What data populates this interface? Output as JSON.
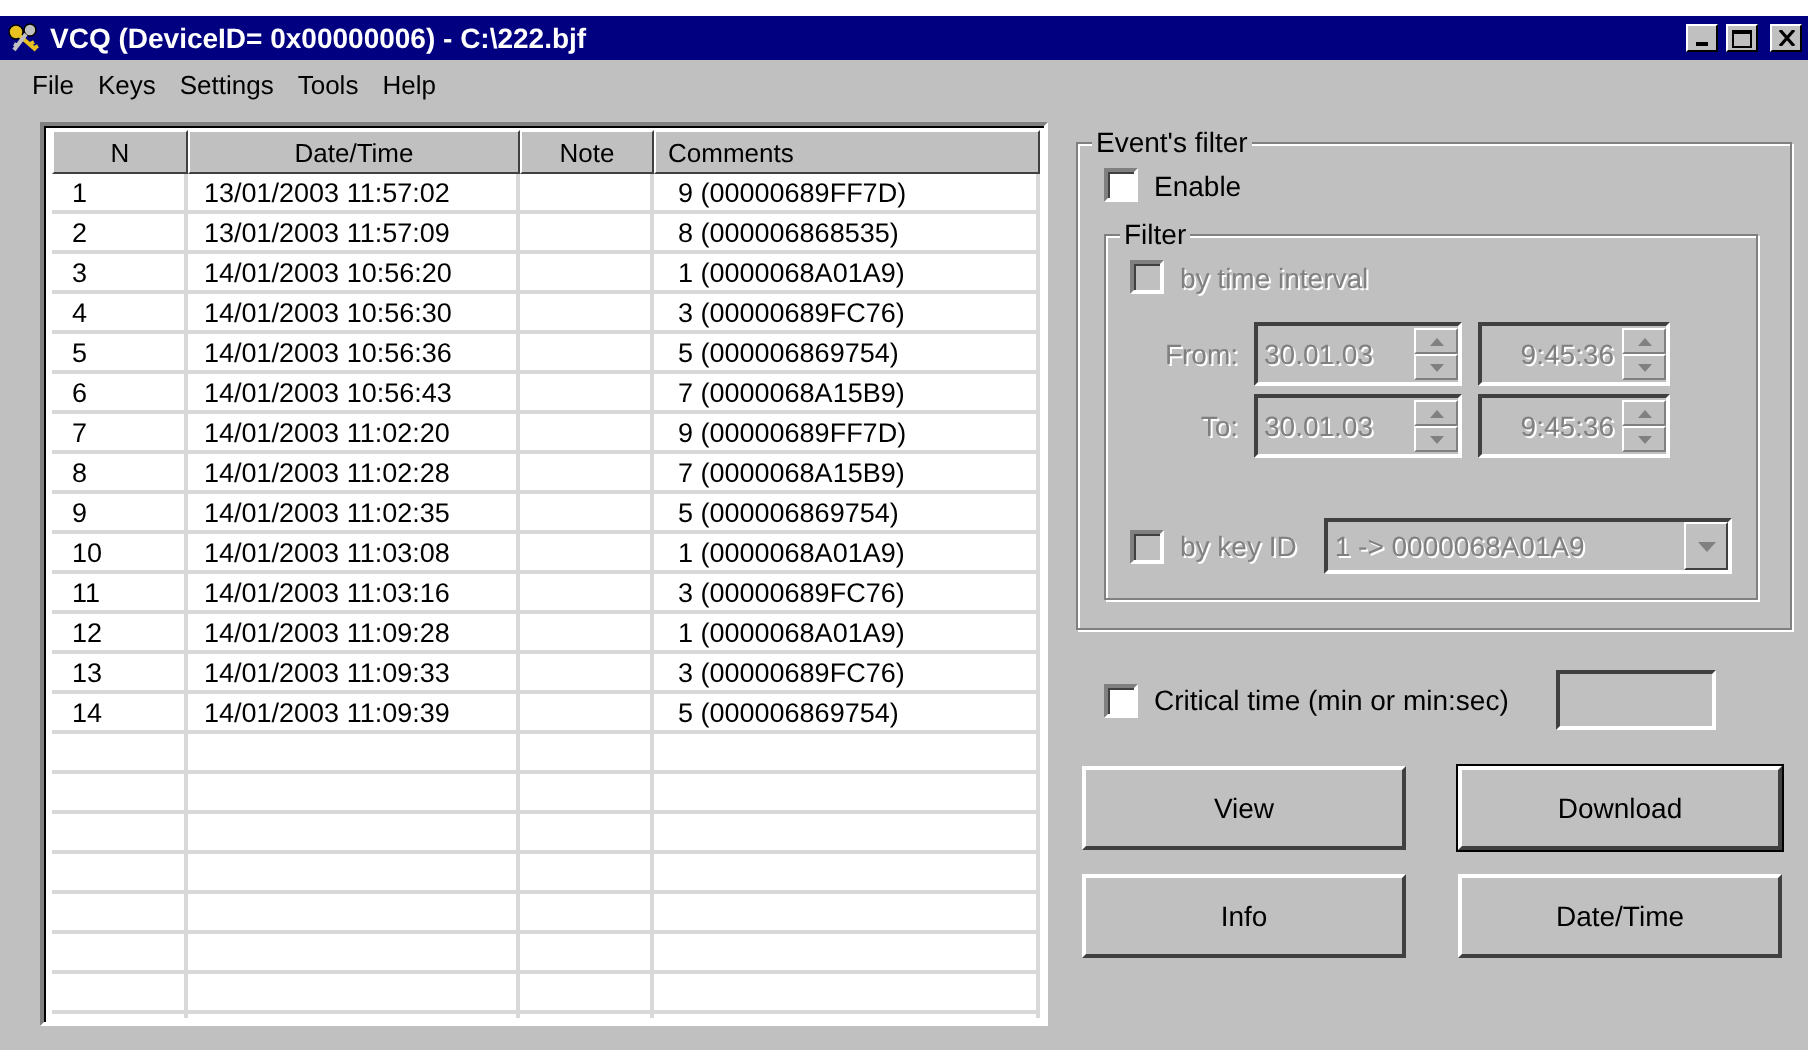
{
  "window": {
    "title": "VCQ (DeviceID= 0x00000006) - C:\\222.bjf"
  },
  "menu": [
    {
      "label": "File"
    },
    {
      "label": "Keys"
    },
    {
      "label": "Settings"
    },
    {
      "label": "Tools"
    },
    {
      "label": "Help"
    }
  ],
  "table": {
    "columns": [
      "N",
      "Date/Time",
      "Note",
      "Comments"
    ],
    "rows": [
      {
        "n": "1",
        "datetime": "13/01/2003 11:57:02",
        "comments": "9 (00000689FF7D)"
      },
      {
        "n": "2",
        "datetime": "13/01/2003 11:57:09",
        "comments": "8 (000006868535)"
      },
      {
        "n": "3",
        "datetime": "14/01/2003 10:56:20",
        "comments": "1 (0000068A01A9)"
      },
      {
        "n": "4",
        "datetime": "14/01/2003 10:56:30",
        "comments": "3 (00000689FC76)"
      },
      {
        "n": "5",
        "datetime": "14/01/2003 10:56:36",
        "comments": "5 (000006869754)"
      },
      {
        "n": "6",
        "datetime": "14/01/2003 10:56:43",
        "comments": "7 (0000068A15B9)"
      },
      {
        "n": "7",
        "datetime": "14/01/2003 11:02:20",
        "comments": "9 (00000689FF7D)"
      },
      {
        "n": "8",
        "datetime": "14/01/2003 11:02:28",
        "comments": "7 (0000068A15B9)"
      },
      {
        "n": "9",
        "datetime": "14/01/2003 11:02:35",
        "comments": "5 (000006869754)"
      },
      {
        "n": "10",
        "datetime": "14/01/2003 11:03:08",
        "comments": "1 (0000068A01A9)"
      },
      {
        "n": "11",
        "datetime": "14/01/2003 11:03:16",
        "comments": "3 (00000689FC76)"
      },
      {
        "n": "12",
        "datetime": "14/01/2003 11:09:28",
        "comments": "1 (0000068A01A9)"
      },
      {
        "n": "13",
        "datetime": "14/01/2003 11:09:33",
        "comments": "3 (00000689FC76)"
      },
      {
        "n": "14",
        "datetime": "14/01/2003 11:09:39",
        "comments": "5 (000006869754)"
      }
    ]
  },
  "events_filter": {
    "title": "Event's filter",
    "enable": {
      "label": "Enable",
      "checked": false
    },
    "filter": {
      "title": "Filter",
      "disabled": true,
      "time_interval": {
        "label": "by time interval",
        "checked": false
      },
      "from": {
        "label": "From:",
        "date": "30.01.03",
        "time": "9:45:36"
      },
      "to": {
        "label": "To:",
        "date": "30.01.03",
        "time": "9:45:36"
      },
      "key_id": {
        "label": "by key ID",
        "checked": false,
        "value": "1 -> 0000068A01A9"
      }
    }
  },
  "critical_time": {
    "label": "Critical time (min or min:sec)",
    "checked": false
  },
  "buttons": [
    {
      "label": "View",
      "default": false
    },
    {
      "label": "Download",
      "default": true
    },
    {
      "label": "Info",
      "default": false
    },
    {
      "label": "Date/Time",
      "default": false
    }
  ]
}
